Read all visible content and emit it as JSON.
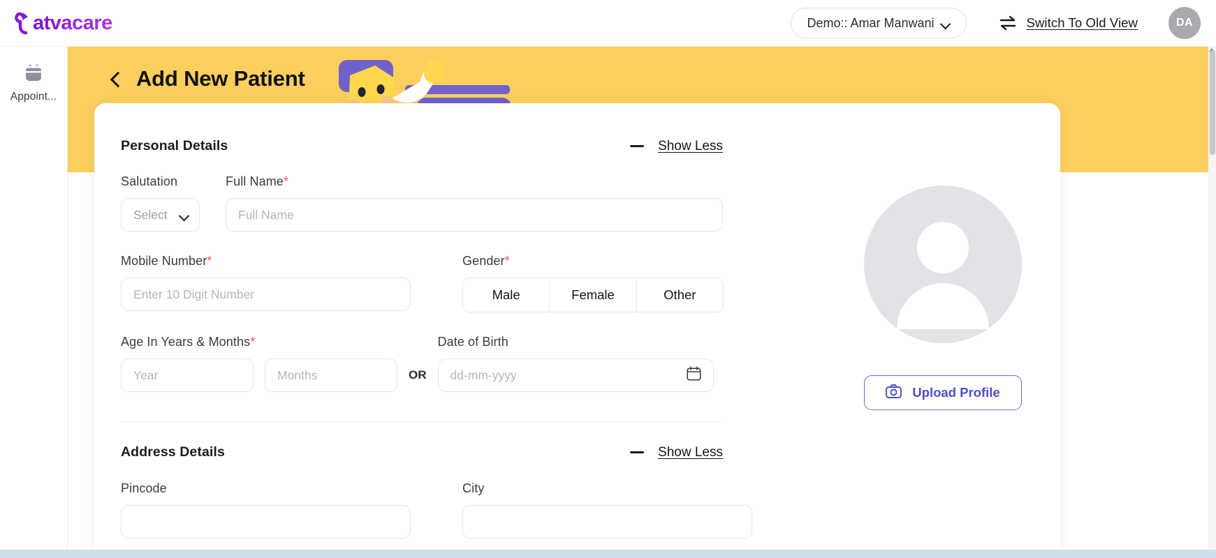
{
  "topbar": {
    "logo_text": "atvacare",
    "logo_icon": "leaf-bird-mark",
    "user_select_value": "Demo:: Amar Manwani",
    "user_select_chevron": "chevron-down-icon",
    "switch_view_label": "Switch To Old View",
    "switch_view_icon": "swap-arrows-icon",
    "avatar_initials": "DA"
  },
  "sidebar": {
    "items": [
      {
        "label": "Appoint...",
        "icon": "calendar-icon"
      }
    ]
  },
  "banner": {
    "back_icon": "chevron-left-icon",
    "title": "Add New Patient",
    "illustration": "patient-character-illustration",
    "bg_color": "#fbcf5e"
  },
  "form": {
    "sections": [
      {
        "title": "Personal Details",
        "toggle_label": "Show Less",
        "toggle_icon": "minus-icon"
      },
      {
        "title": "Address Details",
        "toggle_label": "Show Less",
        "toggle_icon": "minus-icon"
      }
    ],
    "personal": {
      "salutation_label": "Salutation",
      "salutation_value": "Select",
      "salutation_chevron": "chevron-down-icon",
      "fullname_label": "Full Name",
      "fullname_required": "*",
      "fullname_placeholder": "Full Name",
      "mobile_label": "Mobile Number",
      "mobile_required": "*",
      "mobile_placeholder": "Enter 10 Digit Number",
      "gender_label": "Gender",
      "gender_required": "*",
      "gender_options": [
        "Male",
        "Female",
        "Other"
      ],
      "age_label": "Age In Years & Months",
      "age_required": "*",
      "age_year_placeholder": "Year",
      "age_months_placeholder": "Months",
      "or_text": "OR",
      "dob_label": "Date of Birth",
      "dob_placeholder": "dd-mm-yyyy",
      "dob_icon": "calendar-icon"
    },
    "address": {
      "pincode_label": "Pincode",
      "city_label": "City"
    },
    "profile": {
      "avatar_placeholder_icon": "person-placeholder-icon",
      "upload_label": "Upload Profile",
      "upload_icon": "camera-icon",
      "accent_color": "#4f4fc4"
    }
  }
}
